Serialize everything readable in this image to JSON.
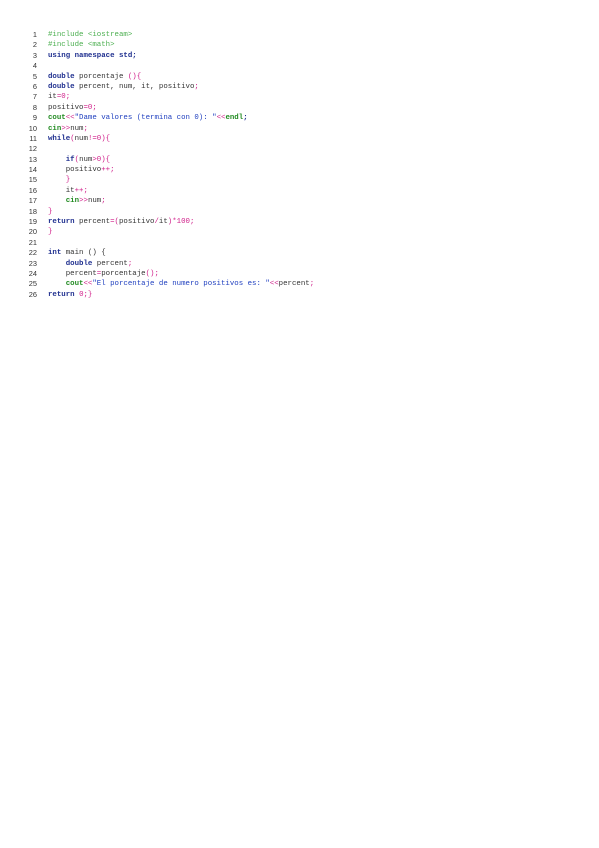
{
  "document": {
    "language": "C++",
    "lines": [
      {
        "no": "1",
        "tokens": [
          {
            "t": "#include <iostream>",
            "c": "pp"
          }
        ]
      },
      {
        "no": "2",
        "tokens": [
          {
            "t": "#include <math>",
            "c": "pp"
          }
        ]
      },
      {
        "no": "3",
        "tokens": [
          {
            "t": "using",
            "c": "kw"
          },
          {
            "t": " ",
            "c": "id"
          },
          {
            "t": "namespace",
            "c": "kw"
          },
          {
            "t": " ",
            "c": "id"
          },
          {
            "t": "std",
            "c": "kw"
          },
          {
            "t": ";",
            "c": "kw"
          }
        ]
      },
      {
        "no": "4",
        "tokens": []
      },
      {
        "no": "5",
        "tokens": [
          {
            "t": "double",
            "c": "kw"
          },
          {
            "t": " porcentaje ",
            "c": "id"
          },
          {
            "t": "(){",
            "c": "op"
          }
        ]
      },
      {
        "no": "6",
        "tokens": [
          {
            "t": "double",
            "c": "kw"
          },
          {
            "t": " percent, num, it, positivo",
            "c": "id"
          },
          {
            "t": ";",
            "c": "op"
          }
        ]
      },
      {
        "no": "7",
        "tokens": [
          {
            "t": "it",
            "c": "id"
          },
          {
            "t": "=0;",
            "c": "op"
          }
        ]
      },
      {
        "no": "8",
        "tokens": [
          {
            "t": "positivo",
            "c": "id"
          },
          {
            "t": "=0;",
            "c": "op"
          }
        ]
      },
      {
        "no": "9",
        "tokens": [
          {
            "t": "cout",
            "c": "std"
          },
          {
            "t": "<<",
            "c": "op"
          },
          {
            "t": "\"Dame valores (termina con 0): \"",
            "c": "str"
          },
          {
            "t": "<<",
            "c": "op"
          },
          {
            "t": "endl",
            "c": "std"
          },
          {
            "t": ";",
            "c": "kw"
          }
        ]
      },
      {
        "no": "10",
        "tokens": [
          {
            "t": "cin",
            "c": "std"
          },
          {
            "t": ">>",
            "c": "op"
          },
          {
            "t": "num",
            "c": "id"
          },
          {
            "t": ";",
            "c": "op"
          }
        ]
      },
      {
        "no": "11",
        "tokens": [
          {
            "t": "while",
            "c": "kw"
          },
          {
            "t": "(",
            "c": "op"
          },
          {
            "t": "num",
            "c": "id"
          },
          {
            "t": "!=0){",
            "c": "op"
          }
        ]
      },
      {
        "no": "12",
        "tokens": []
      },
      {
        "no": "13",
        "tokens": [
          {
            "t": "    ",
            "c": "id"
          },
          {
            "t": "if",
            "c": "kw"
          },
          {
            "t": "(",
            "c": "op"
          },
          {
            "t": "num",
            "c": "id"
          },
          {
            "t": ">0){",
            "c": "op"
          }
        ]
      },
      {
        "no": "14",
        "tokens": [
          {
            "t": "    positivo",
            "c": "id"
          },
          {
            "t": "++;",
            "c": "op"
          }
        ]
      },
      {
        "no": "15",
        "tokens": [
          {
            "t": "    ",
            "c": "id"
          },
          {
            "t": "}",
            "c": "op"
          }
        ]
      },
      {
        "no": "16",
        "tokens": [
          {
            "t": "    it",
            "c": "id"
          },
          {
            "t": "++;",
            "c": "op"
          }
        ]
      },
      {
        "no": "17",
        "tokens": [
          {
            "t": "    ",
            "c": "id"
          },
          {
            "t": "cin",
            "c": "std"
          },
          {
            "t": ">>",
            "c": "op"
          },
          {
            "t": "num",
            "c": "id"
          },
          {
            "t": ";",
            "c": "op"
          }
        ]
      },
      {
        "no": "18",
        "tokens": [
          {
            "t": "}",
            "c": "op"
          }
        ]
      },
      {
        "no": "19",
        "tokens": [
          {
            "t": "return",
            "c": "kw"
          },
          {
            "t": " percent",
            "c": "id"
          },
          {
            "t": "=(",
            "c": "op"
          },
          {
            "t": "positivo",
            "c": "id"
          },
          {
            "t": "/",
            "c": "op"
          },
          {
            "t": "it",
            "c": "id"
          },
          {
            "t": ")*100;",
            "c": "op"
          }
        ]
      },
      {
        "no": "20",
        "tokens": [
          {
            "t": "}",
            "c": "op"
          }
        ]
      },
      {
        "no": "21",
        "tokens": []
      },
      {
        "no": "22",
        "tokens": [
          {
            "t": "int",
            "c": "kw"
          },
          {
            "t": " main () {",
            "c": "id"
          }
        ]
      },
      {
        "no": "23",
        "tokens": [
          {
            "t": "    ",
            "c": "id"
          },
          {
            "t": "double",
            "c": "kw"
          },
          {
            "t": " percent",
            "c": "id"
          },
          {
            "t": ";",
            "c": "op"
          }
        ]
      },
      {
        "no": "24",
        "tokens": [
          {
            "t": "    percent",
            "c": "id"
          },
          {
            "t": "=",
            "c": "op"
          },
          {
            "t": "porcentaje",
            "c": "id"
          },
          {
            "t": "();",
            "c": "op"
          }
        ]
      },
      {
        "no": "25",
        "tokens": [
          {
            "t": "    ",
            "c": "id"
          },
          {
            "t": "cout",
            "c": "std"
          },
          {
            "t": "<<",
            "c": "op"
          },
          {
            "t": "\"El porcentaje de numero positivos es: \"",
            "c": "str"
          },
          {
            "t": "<<",
            "c": "op"
          },
          {
            "t": "percent",
            "c": "id"
          },
          {
            "t": ";",
            "c": "op"
          }
        ]
      },
      {
        "no": "26",
        "tokens": [
          {
            "t": "return",
            "c": "kw"
          },
          {
            "t": " ",
            "c": "id"
          },
          {
            "t": "0;}",
            "c": "op"
          }
        ]
      }
    ]
  }
}
